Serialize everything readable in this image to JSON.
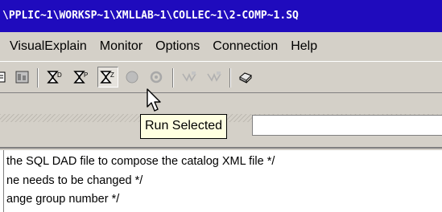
{
  "window": {
    "title": "\\PPLIC~1\\WORKSP~1\\XMLLAB~1\\COLLEC~1\\2-COMP~1.SQ"
  },
  "menubar": {
    "items": [
      {
        "label": "VisualExplain"
      },
      {
        "label": "Monitor"
      },
      {
        "label": "Options"
      },
      {
        "label": "Connection"
      },
      {
        "label": "Help"
      }
    ]
  },
  "toolbar": {
    "buttons": [
      {
        "icon": "schema-icon"
      },
      {
        "icon": "database-icon"
      },
      {
        "icon": "run-all-icon"
      },
      {
        "icon": "run-step-icon"
      },
      {
        "icon": "run-selected-icon",
        "pressed": true
      },
      {
        "icon": "stop-record-icon"
      },
      {
        "icon": "cancel-icon"
      },
      {
        "icon": "explain-icon"
      },
      {
        "icon": "explain-selected-icon"
      },
      {
        "icon": "print-icon"
      }
    ],
    "tooltip": "Run Selected"
  },
  "editor": {
    "lines": [
      "the SQL DAD file to compose the catalog XML file */",
      "ne needs to be changed */",
      "ange group number */"
    ]
  },
  "colors": {
    "titlebar": "#1f0bbd",
    "chrome": "#d4d0c8",
    "tooltip_bg": "#ffffe1"
  }
}
